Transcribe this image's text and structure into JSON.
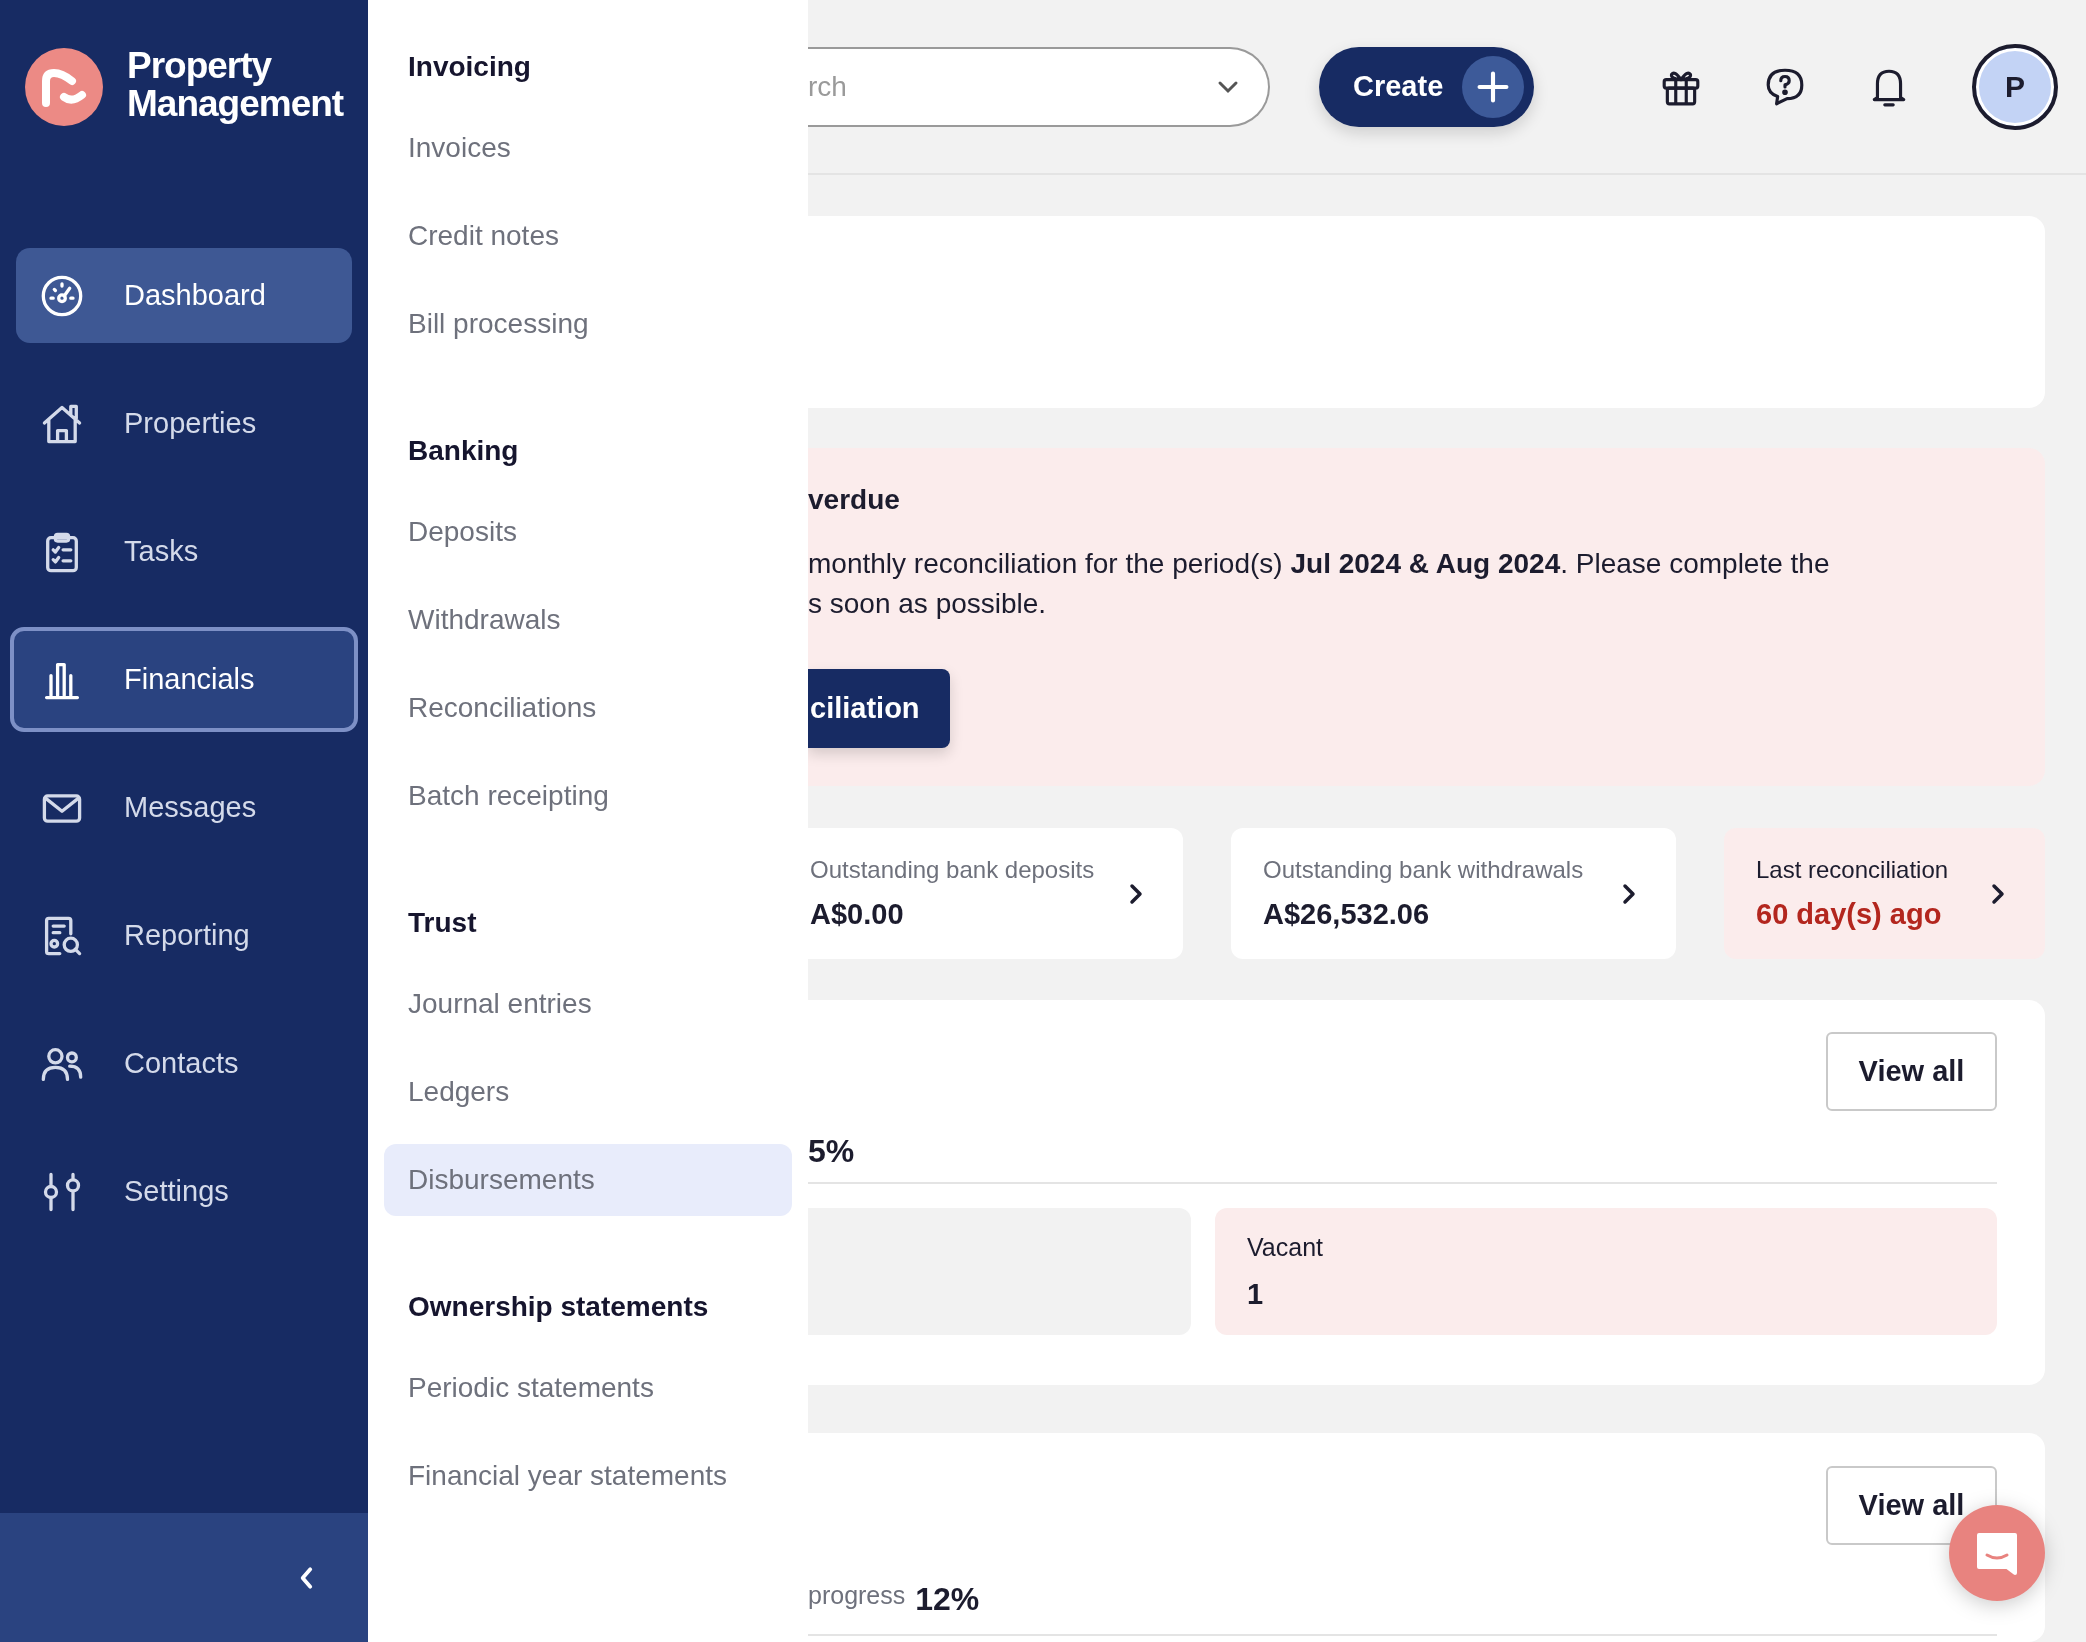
{
  "brand": {
    "name": "Property Management"
  },
  "nav": [
    {
      "label": "Dashboard",
      "selected": true,
      "expanded": false
    },
    {
      "label": "Properties",
      "selected": false,
      "expanded": false
    },
    {
      "label": "Tasks",
      "selected": false,
      "expanded": false
    },
    {
      "label": "Financials",
      "selected": false,
      "expanded": true
    },
    {
      "label": "Messages",
      "selected": false,
      "expanded": false
    },
    {
      "label": "Reporting",
      "selected": false,
      "expanded": false
    },
    {
      "label": "Contacts",
      "selected": false,
      "expanded": false
    },
    {
      "label": "Settings",
      "selected": false,
      "expanded": false
    }
  ],
  "flyout": {
    "sections": [
      {
        "heading": "Invoicing",
        "items": [
          {
            "label": "Invoices",
            "selected": false
          },
          {
            "label": "Credit notes",
            "selected": false
          },
          {
            "label": "Bill processing",
            "selected": false
          }
        ]
      },
      {
        "heading": "Banking",
        "items": [
          {
            "label": "Deposits",
            "selected": false
          },
          {
            "label": "Withdrawals",
            "selected": false
          },
          {
            "label": "Reconciliations",
            "selected": false
          },
          {
            "label": "Batch receipting",
            "selected": false
          }
        ]
      },
      {
        "heading": "Trust",
        "items": [
          {
            "label": "Journal entries",
            "selected": false
          },
          {
            "label": "Ledgers",
            "selected": false
          },
          {
            "label": "Disbursements",
            "selected": true
          }
        ]
      },
      {
        "heading": "Ownership statements",
        "items": [
          {
            "label": "Periodic statements",
            "selected": false
          },
          {
            "label": "Financial year statements",
            "selected": false
          }
        ]
      }
    ]
  },
  "topbar": {
    "search": {
      "placeholder": "rch"
    },
    "create_button": {
      "label": "Create"
    },
    "avatar": {
      "initial": "P"
    }
  },
  "overdue_alert": {
    "title": "verdue",
    "message": "monthly reconciliation for the period(s) **Jul 2024 & Aug 2024**. Please complete the\ns soon as possible.",
    "button": "ciliation"
  },
  "stats": [
    {
      "label": "Outstanding bank deposits",
      "value": "A$0.00",
      "alert": false
    },
    {
      "label": "Outstanding bank withdrawals",
      "value": "A$26,532.06",
      "alert": false
    },
    {
      "label": "Last reconciliation",
      "value": "60 day(s) ago",
      "alert": true
    }
  ],
  "occupancy": {
    "button": "View all",
    "rate": "5%",
    "tiles": [
      {
        "label": "Vacant",
        "value": "1",
        "alert": true
      }
    ]
  },
  "tasks": {
    "button": "View all",
    "caption": "progress",
    "rate": "12%"
  }
}
